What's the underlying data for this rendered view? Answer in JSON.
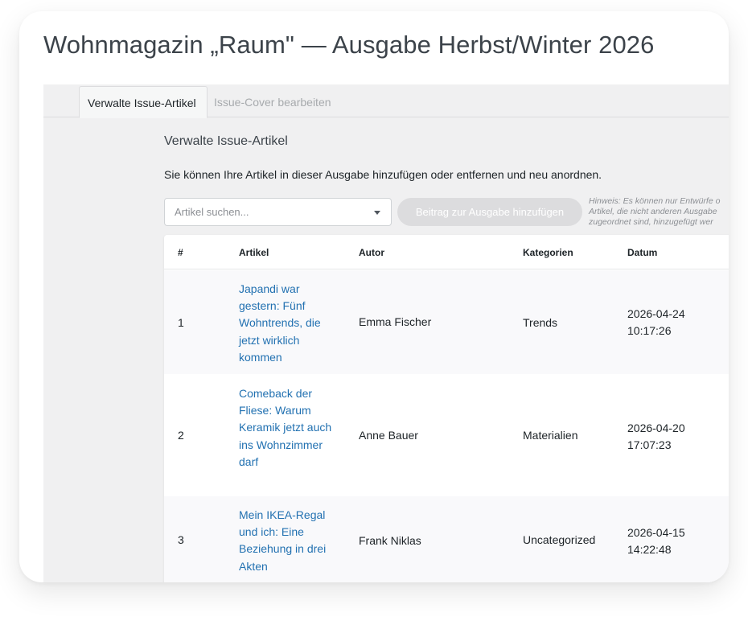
{
  "page": {
    "title": "Wohnmagazin „Raum\" — Ausgabe Herbst/Winter 2026"
  },
  "tabs": [
    {
      "label": "Verwalte Issue-Artikel",
      "active": true
    },
    {
      "label": "Issue-Cover bearbeiten",
      "active": false
    }
  ],
  "section": {
    "title": "Verwalte Issue-Artikel",
    "description": "Sie können Ihre Artikel in dieser Ausgabe hinzufügen oder entfernen und neu anordnen."
  },
  "controls": {
    "search_placeholder": "Artikel suchen...",
    "add_button": "Beitrag zur Ausgabe hinzufügen",
    "hint_line1": "Hinweis: Es können nur Entwürfe o",
    "hint_line2": "Artikel, die nicht anderen Ausgabe",
    "hint_line3": "zugeordnet sind, hinzugefügt wer"
  },
  "table": {
    "headers": {
      "num": "#",
      "article": "Artikel",
      "author": "Autor",
      "categories": "Kategorien",
      "date": "Datum"
    },
    "rows": [
      {
        "num": "1",
        "title": "Japandi war gestern: Fünf Wohntrends, die jetzt wirklich kommen",
        "author": "Emma Fischer",
        "category": "Trends",
        "date": "2026-04-24",
        "time": "10:17:26"
      },
      {
        "num": "2",
        "title": "Comeback der Fliese: Warum Keramik jetzt auch ins Wohnzimmer darf",
        "author": "Anne Bauer",
        "category": "Materialien",
        "date": "2026-04-20",
        "time": "17:07:23"
      },
      {
        "num": "3",
        "title": "Mein IKEA-Regal und ich: Eine Beziehung in drei Akten",
        "author": "Frank Niklas",
        "category": "Uncategorized",
        "date": "2026-04-15",
        "time": "14:22:48"
      }
    ]
  },
  "colors": {
    "link": "#2271b1",
    "panel_bg": "#f0f0f1",
    "button_disabled": "#dcdcde"
  }
}
